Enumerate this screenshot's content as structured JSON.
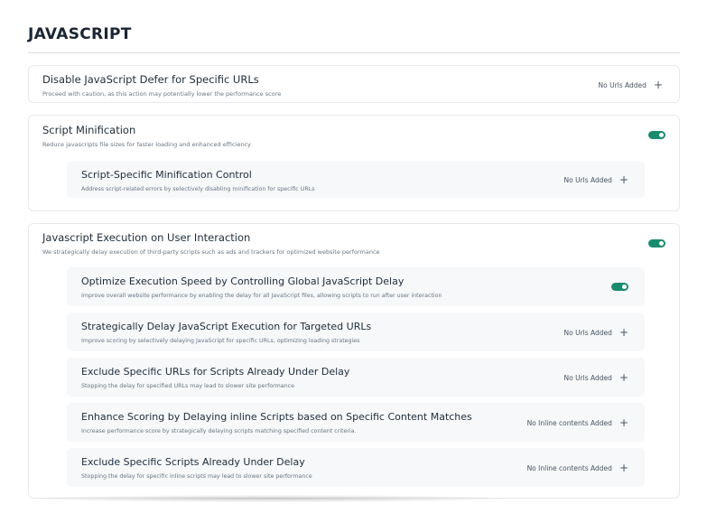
{
  "section": {
    "title": "JAVASCRIPT"
  },
  "defer": {
    "title": "Disable JavaScript Defer for Specific URLs",
    "desc": "Proceed with caution, as this action may potentially lower the performance score",
    "status": "No Urls Added"
  },
  "minify": {
    "title": "Script Minification",
    "desc": "Reduce javascripts file sizes for faster loading and enhanced efficiency",
    "enabled": true,
    "sub": {
      "title": "Script-Specific Minification Control",
      "desc": "Address script-related errors by selectively disabling minification for specific URLs",
      "status": "No Urls Added"
    }
  },
  "execution": {
    "title": "Javascript Execution on User Interaction",
    "desc": "We strategically delay execution of third-party scripts such as ads and trackers for optimized website performance",
    "enabled": true,
    "items": [
      {
        "title": "Optimize Execution Speed by Controlling Global JavaScript Delay",
        "desc": "Improve overall website performance by enabling the delay for all JavaScript files, allowing scripts to run after user interaction",
        "enabled": true
      },
      {
        "title": "Strategically Delay JavaScript Execution for Targeted URLs",
        "desc": "Improve scoring by selectively delaying JavaScript for specific URLs, optimizing loading strategies",
        "status": "No Urls Added"
      },
      {
        "title": "Exclude Specific URLs for Scripts Already Under Delay",
        "desc": "Stopping the delay for specified URLs may lead to slower site performance",
        "status": "No Urls Added"
      },
      {
        "title": "Enhance Scoring by Delaying inline Scripts based on Specific Content Matches",
        "desc": "Increase performance score by strategically delaying scripts matching specified content criteria.",
        "status": "No Inline contents Added"
      },
      {
        "title": "Exclude Specific Scripts Already Under Delay",
        "desc": "Stopping the delay for specific inline scripts may lead to slower site performance",
        "status": "No Inline contents Added"
      }
    ]
  },
  "icons": {
    "add": "plus-icon"
  },
  "colors": {
    "toggle_on": "#1a8c6e",
    "card_border": "#e6e9ed",
    "sub_bg": "#f6f8fa"
  }
}
